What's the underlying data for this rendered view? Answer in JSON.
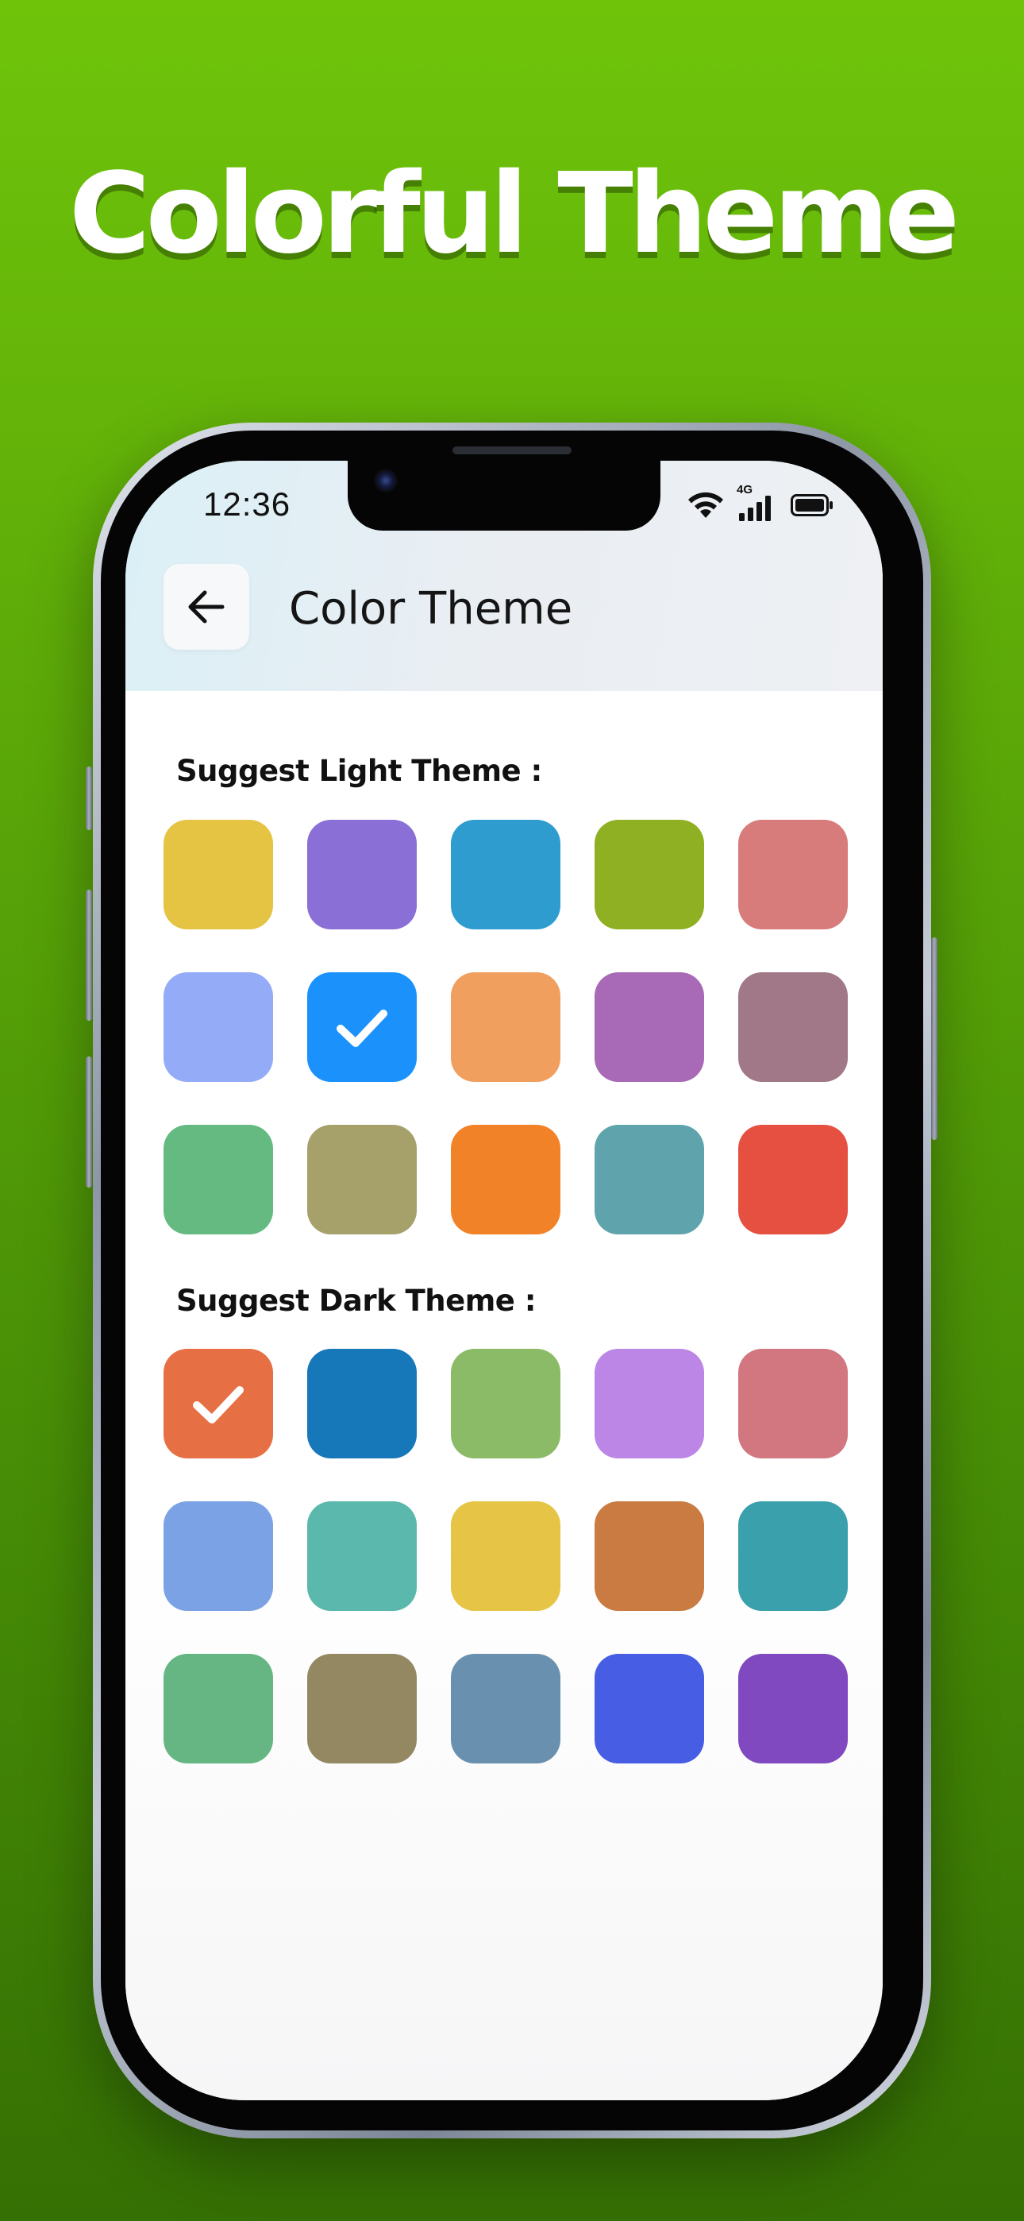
{
  "promo": {
    "headline": "Colorful Theme"
  },
  "status_bar": {
    "time": "12:36",
    "network": "4G",
    "icons": [
      "wifi-icon",
      "cellular-signal-icon",
      "battery-icon"
    ]
  },
  "header": {
    "title": "Color Theme",
    "back_icon": "arrow-left-icon"
  },
  "light_section": {
    "label": "Suggest Light Theme :",
    "swatches": [
      {
        "color": "#E6C443",
        "selected": false
      },
      {
        "color": "#8A6FD6",
        "selected": false
      },
      {
        "color": "#2E9CCF",
        "selected": false
      },
      {
        "color": "#8FB023",
        "selected": false
      },
      {
        "color": "#D77B7B",
        "selected": false
      },
      {
        "color": "#94ABF8",
        "selected": false
      },
      {
        "color": "#1B92FB",
        "selected": true
      },
      {
        "color": "#F09F5F",
        "selected": false
      },
      {
        "color": "#A869B6",
        "selected": false
      },
      {
        "color": "#A07888",
        "selected": false
      },
      {
        "color": "#64BA80",
        "selected": false
      },
      {
        "color": "#A6A06A",
        "selected": false
      },
      {
        "color": "#F28227",
        "selected": false
      },
      {
        "color": "#5FA4AC",
        "selected": false
      },
      {
        "color": "#E65040",
        "selected": false
      }
    ]
  },
  "dark_section": {
    "label": "Suggest Dark Theme :",
    "swatches": [
      {
        "color": "#E66F43",
        "selected": true
      },
      {
        "color": "#1778B9",
        "selected": false
      },
      {
        "color": "#8BBB66",
        "selected": false
      },
      {
        "color": "#BC86E6",
        "selected": false
      },
      {
        "color": "#D27780",
        "selected": false
      },
      {
        "color": "#7BA2E4",
        "selected": false
      },
      {
        "color": "#5AB9AC",
        "selected": false
      },
      {
        "color": "#E6C446",
        "selected": false
      },
      {
        "color": "#C97B41",
        "selected": false
      },
      {
        "color": "#3AA0AC",
        "selected": false
      },
      {
        "color": "#66B683",
        "selected": false
      },
      {
        "color": "#948863",
        "selected": false
      },
      {
        "color": "#6990AE",
        "selected": false
      },
      {
        "color": "#465DE4",
        "selected": false
      },
      {
        "color": "#8049C0",
        "selected": false
      }
    ]
  },
  "theme": {
    "background_top": "#6FC40A",
    "background_bottom": "#357004",
    "check_color": "#FFFFFF"
  }
}
